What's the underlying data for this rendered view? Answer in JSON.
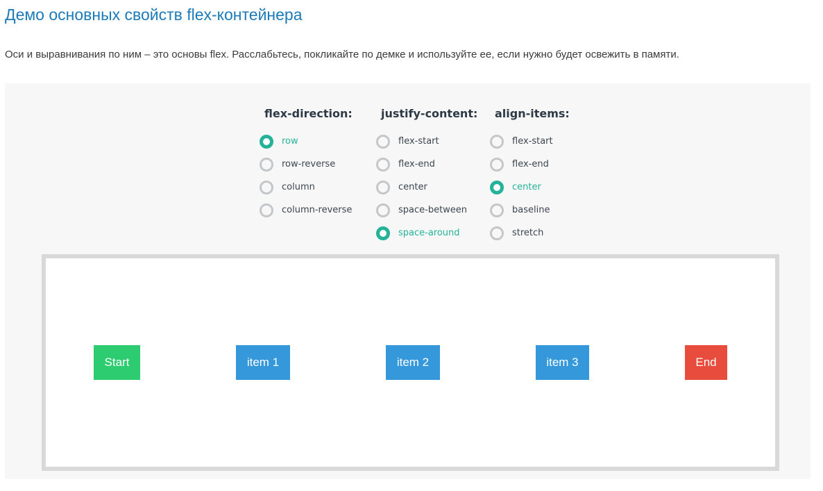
{
  "title": "Демо основных свойств flex-контейнера",
  "intro": "Оси и выравнивания по ним – это основы flex. Расслабьтесь, покликайте по демке и используйте ее, если нужно будет освежить в памяти.",
  "colors": {
    "accent": "#24b399",
    "title": "#1b7ab8",
    "start": "#2ecc71",
    "item": "#3498db",
    "end": "#e74c3c"
  },
  "controls": {
    "flex_direction": {
      "title": "flex-direction:",
      "selected": "row",
      "options": [
        "row",
        "row-reverse",
        "column",
        "column-reverse"
      ]
    },
    "justify_content": {
      "title": "justify-content:",
      "selected": "space-around",
      "options": [
        "flex-start",
        "flex-end",
        "center",
        "space-between",
        "space-around"
      ]
    },
    "align_items": {
      "title": "align-items:",
      "selected": "center",
      "options": [
        "flex-start",
        "flex-end",
        "center",
        "baseline",
        "stretch"
      ]
    }
  },
  "stage": {
    "items": [
      "Start",
      "item 1",
      "item 2",
      "item 3",
      "End"
    ]
  }
}
